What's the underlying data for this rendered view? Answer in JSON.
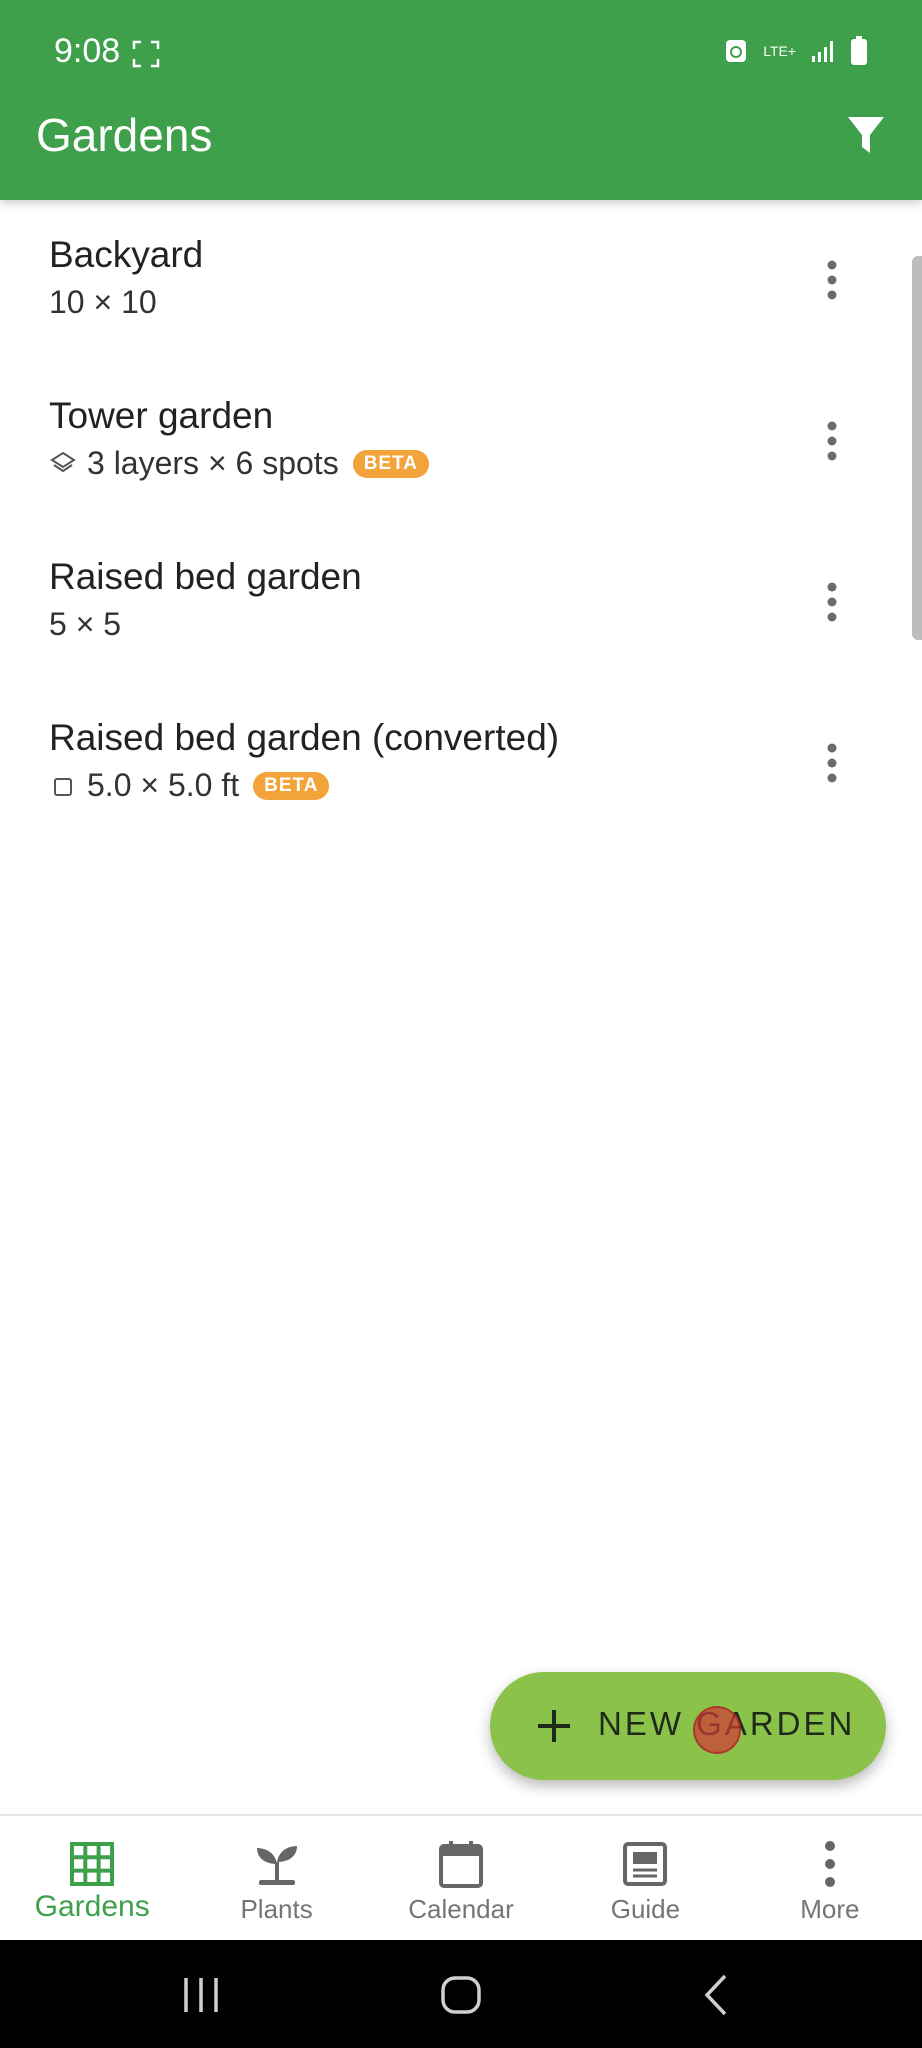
{
  "status_bar": {
    "time": "9:08",
    "network": "LTE+"
  },
  "app_bar": {
    "title": "Gardens",
    "filter_icon": "filter-icon"
  },
  "gardens": [
    {
      "name": "Backyard",
      "detail": "10 × 10",
      "icon": "",
      "beta": ""
    },
    {
      "name": "Tower garden",
      "detail": "3 layers × 6 spots",
      "icon": "layers-icon",
      "beta": "BETA"
    },
    {
      "name": "Raised bed garden",
      "detail": "5 × 5",
      "icon": "",
      "beta": ""
    },
    {
      "name": "Raised bed garden (converted)",
      "detail": "5.0 × 5.0 ft",
      "icon": "square-icon",
      "beta": "BETA"
    }
  ],
  "fab": {
    "label": "NEW GARDEN"
  },
  "bottom_nav": [
    {
      "label": "Gardens",
      "icon": "grid-icon",
      "active": true
    },
    {
      "label": "Plants",
      "icon": "sprout-icon",
      "active": false
    },
    {
      "label": "Calendar",
      "icon": "calendar-icon",
      "active": false
    },
    {
      "label": "Guide",
      "icon": "guide-icon",
      "active": false
    },
    {
      "label": "More",
      "icon": "more-vertical-icon",
      "active": false
    }
  ],
  "colors": {
    "primary": "#3ea04a",
    "fab": "#8bc34a",
    "beta_badge": "#f2a33a"
  }
}
